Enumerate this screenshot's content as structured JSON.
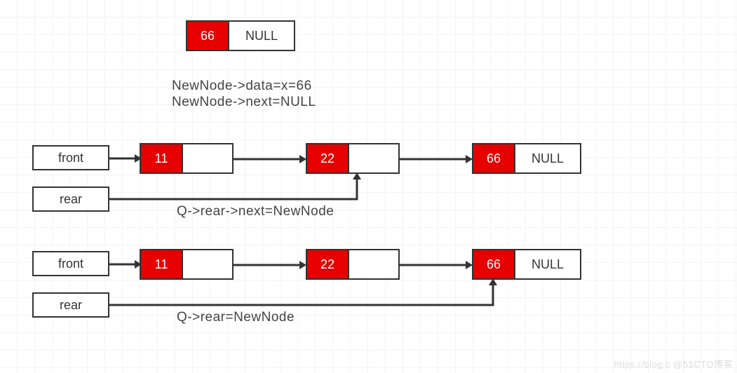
{
  "topNode": {
    "data": "66",
    "next": "NULL"
  },
  "caption1_line1": "NewNode->data=x=66",
  "caption1_line2": "NewNode->next=NULL",
  "row2": {
    "frontLabel": "front",
    "rearLabel": "rear",
    "node1": {
      "data": "11"
    },
    "node2": {
      "data": "22"
    },
    "node3": {
      "data": "66",
      "next": "NULL"
    },
    "caption": "Q->rear->next=NewNode"
  },
  "row3": {
    "frontLabel": "front",
    "rearLabel": "rear",
    "node1": {
      "data": "11"
    },
    "node2": {
      "data": "22"
    },
    "node3": {
      "data": "66",
      "next": "NULL"
    },
    "caption": "Q->rear=NewNode"
  },
  "watermark": "https://blog.c @51CTO博客"
}
